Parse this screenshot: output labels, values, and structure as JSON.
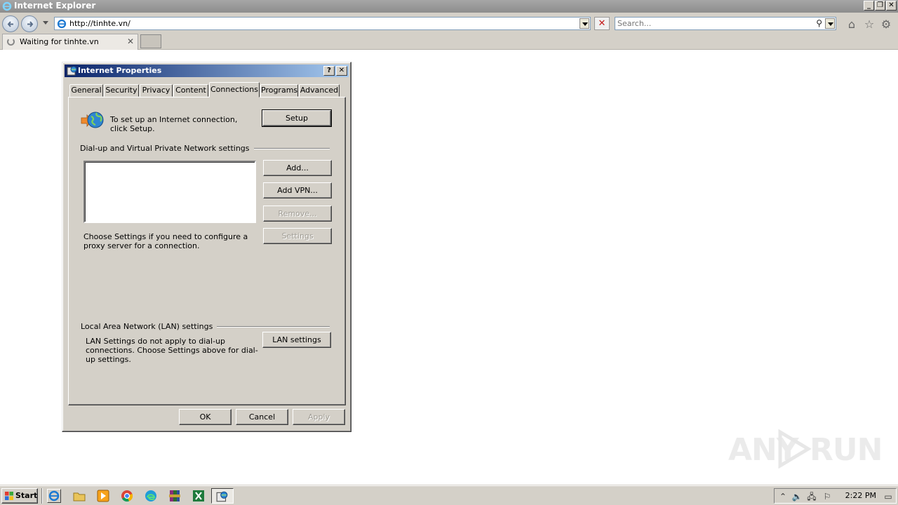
{
  "browser": {
    "window_title": "Internet Explorer",
    "address": "http://tinhte.vn/",
    "search_placeholder": "Search...",
    "tab_label": "Waiting for tinhte.vn",
    "stop_symbol": "✕",
    "tab_close": "✕"
  },
  "dialog": {
    "title": "Internet Properties",
    "help_btn": "?",
    "close_btn": "✕",
    "tabs": [
      "General",
      "Security",
      "Privacy",
      "Content",
      "Connections",
      "Programs",
      "Advanced"
    ],
    "active_tab": "Connections",
    "setup_text": "To set up an Internet connection, click Setup.",
    "setup_button": "Setup",
    "dialup_group": "Dial-up and Virtual Private Network settings",
    "add_button": "Add...",
    "add_vpn_button": "Add VPN...",
    "remove_button": "Remove...",
    "settings_button": "Settings",
    "proxy_text": "Choose Settings if you need to configure a proxy server for a connection.",
    "lan_group": "Local Area Network (LAN) settings",
    "lan_text": "LAN Settings do not apply to dial-up connections. Choose Settings above for dial-up settings.",
    "lan_button": "LAN settings",
    "ok_button": "OK",
    "cancel_button": "Cancel",
    "apply_button": "Apply"
  },
  "taskbar": {
    "start_label": "Start",
    "clock": "2:22 PM"
  },
  "watermark": {
    "left": "ANY",
    "right": "RUN"
  },
  "colors": {
    "dialog_face": "#d4d0c8",
    "title_gradient_start": "#0a246a",
    "title_gradient_end": "#a6caf0"
  }
}
